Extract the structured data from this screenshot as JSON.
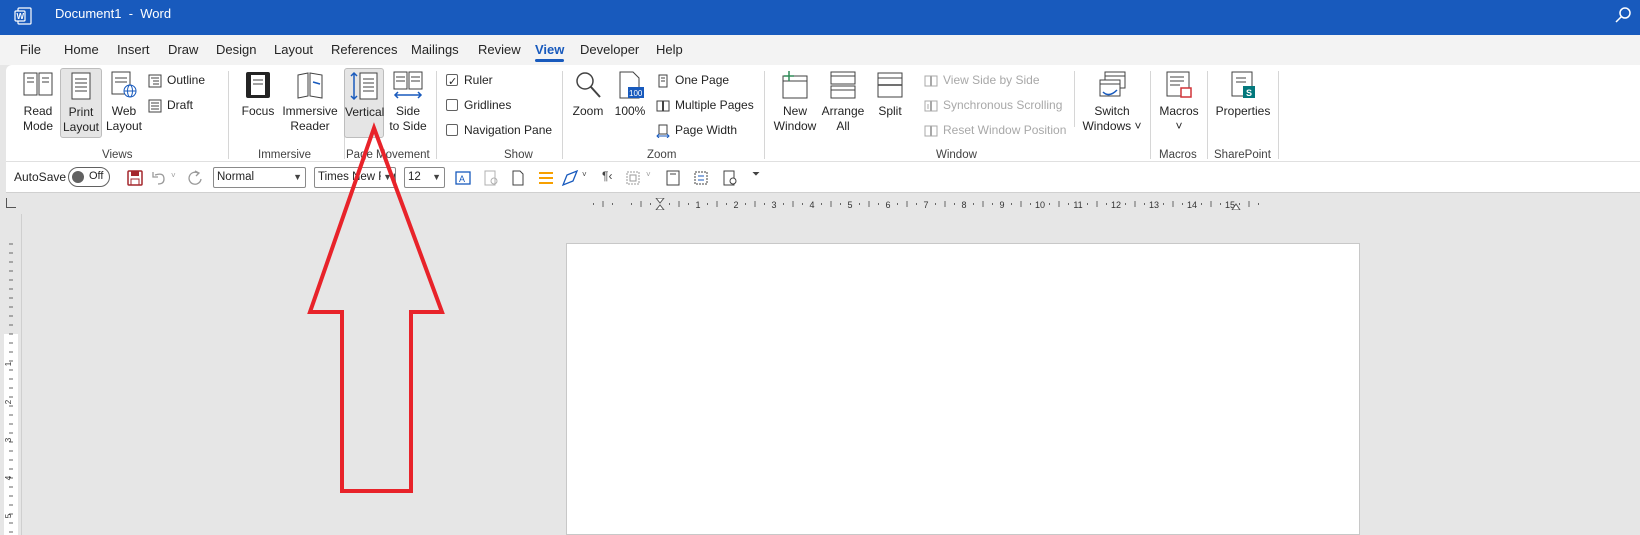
{
  "titlebar": {
    "title": "Document1  -  Word",
    "app_icon": "word-icon",
    "search_icon": "search-icon"
  },
  "tabs": [
    "File",
    "Home",
    "Insert",
    "Draw",
    "Design",
    "Layout",
    "References",
    "Mailings",
    "Review",
    "View",
    "Developer",
    "Help"
  ],
  "active_tab": "View",
  "ribbon": {
    "views": {
      "label": "Views",
      "read_mode": [
        "Read",
        "Mode"
      ],
      "print_layout": [
        "Print",
        "Layout"
      ],
      "web_layout": [
        "Web",
        "Layout"
      ],
      "outline": "Outline",
      "draft": "Draft"
    },
    "immersive": {
      "label": "Immersive",
      "focus": "Focus",
      "immersive_reader": [
        "Immersive",
        "Reader"
      ]
    },
    "page_movement": {
      "label": "Page Movement",
      "vertical": "Vertical",
      "side_to_side": [
        "Side",
        "to Side"
      ]
    },
    "show": {
      "label": "Show",
      "ruler": "Ruler",
      "ruler_checked": true,
      "gridlines": "Gridlines",
      "gridlines_checked": false,
      "navigation_pane": "Navigation Pane",
      "navigation_pane_checked": false
    },
    "zoom": {
      "label": "Zoom",
      "zoom": "Zoom",
      "hundred": "100%",
      "hundred_badge": "100",
      "one_page": "One Page",
      "multiple_pages": "Multiple Pages",
      "page_width": "Page Width"
    },
    "window": {
      "label": "Window",
      "new_window": [
        "New",
        "Window"
      ],
      "arrange_all": [
        "Arrange",
        "All"
      ],
      "split": "Split",
      "view_side_by_side": "View Side by Side",
      "synchronous_scrolling": "Synchronous Scrolling",
      "reset_window_position": "Reset Window Position",
      "switch_windows": [
        "Switch",
        "Windows ˅"
      ]
    },
    "macros": {
      "label": "Macros",
      "macros": "Macros",
      "caret": "˅"
    },
    "sharepoint": {
      "label": "SharePoint",
      "properties": "Properties",
      "badge": "S"
    }
  },
  "qat": {
    "autosave": "AutoSave",
    "autosave_state": "Off",
    "style": "Normal",
    "font": "Times New Roman",
    "size": "12"
  },
  "ruler": {
    "marks": [
      "1",
      "2",
      "3",
      "4",
      "5",
      "6",
      "7",
      "8",
      "9",
      "10",
      "11",
      "12",
      "13",
      "14",
      "15"
    ],
    "vmarks": [
      "1",
      "2",
      "3",
      "4",
      "5"
    ]
  },
  "colors": {
    "accent": "#185abd",
    "arrow": "#e8232a",
    "ribbon_bg": "#ffffff",
    "canvas_bg": "#e6e6e6"
  }
}
